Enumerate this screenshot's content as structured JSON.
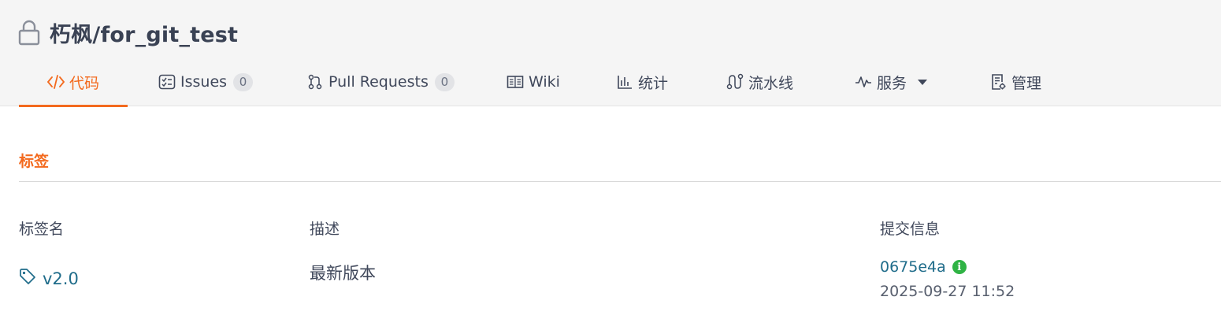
{
  "repo": {
    "title": "朽枫/for_git_test"
  },
  "tabs": [
    {
      "label": "代码",
      "icon": "code-icon",
      "active": true
    },
    {
      "label": "Issues",
      "icon": "issues-icon",
      "count": "0"
    },
    {
      "label": "Pull Requests",
      "icon": "pull-request-icon",
      "count": "0"
    },
    {
      "label": "Wiki",
      "icon": "wiki-book-icon"
    },
    {
      "label": "统计",
      "icon": "bar-chart-icon"
    },
    {
      "label": "流水线",
      "icon": "pipeline-icon"
    },
    {
      "label": "服务",
      "icon": "pulse-icon",
      "dropdown": true
    },
    {
      "label": "管理",
      "icon": "settings-doc-icon"
    }
  ],
  "section": {
    "title": "标签"
  },
  "table": {
    "headers": [
      "标签名",
      "描述",
      "提交信息"
    ],
    "rows": [
      {
        "tag": "v2.0",
        "description": "最新版本",
        "commit": "0675e4a",
        "time": "2025-09-27 11:52"
      }
    ]
  },
  "colors": {
    "accent": "#f36a1e",
    "link": "#1f6c8a",
    "verified": "#2fb344",
    "header_bg": "#f5f5f5"
  }
}
